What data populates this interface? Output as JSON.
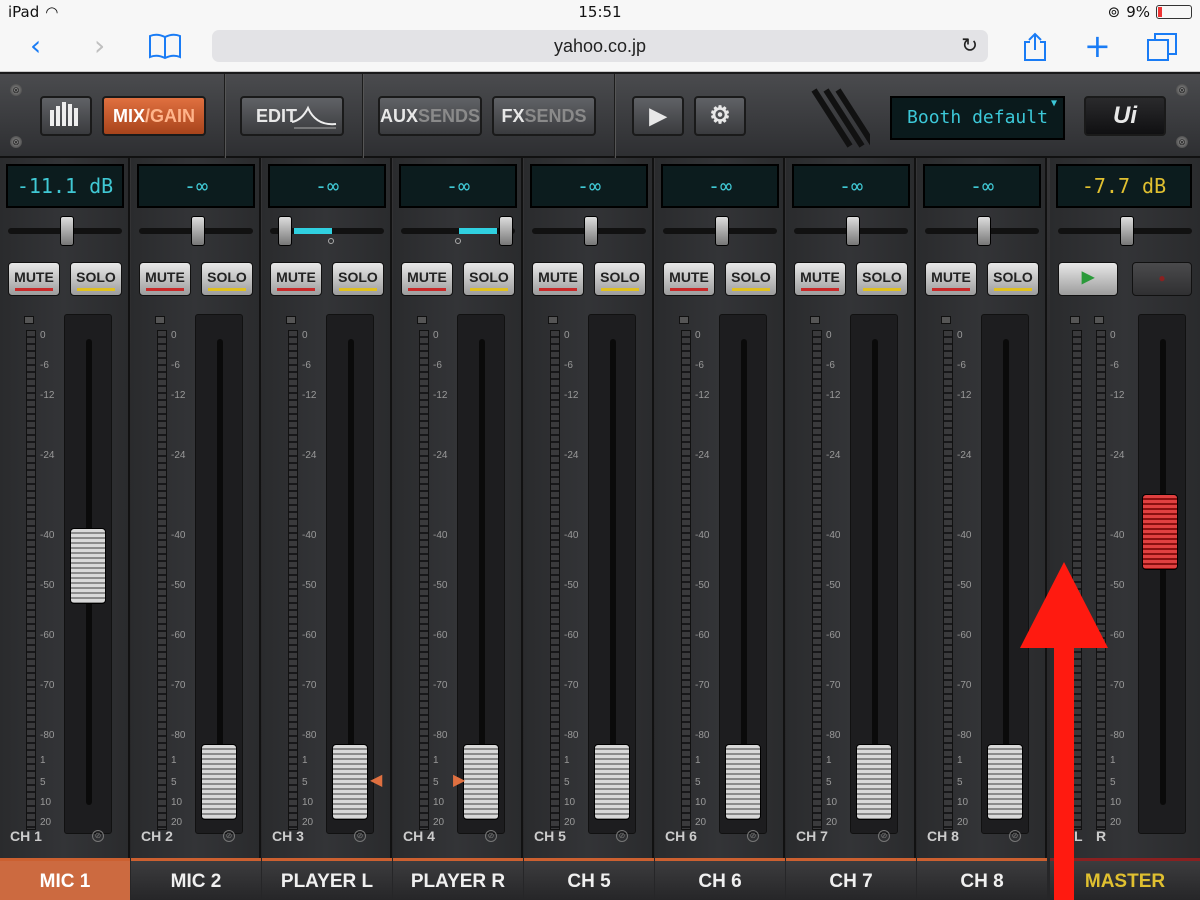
{
  "status": {
    "device": "iPad",
    "time": "15:51",
    "battery": "9%"
  },
  "browser": {
    "url": "yahoo.co.jp",
    "back": "‹",
    "fwd": "›",
    "reload": "↻",
    "share": "⇪",
    "add": "+",
    "tabs": "⧉",
    "bookmarks": "📖"
  },
  "toolbar": {
    "mix": "MIX",
    "gain": "/GAIN",
    "edit": "EDIT",
    "aux": "AUX",
    "auxsends": "SENDS",
    "fx": "FX",
    "fxsends": "SENDS",
    "play": "▶",
    "settings": "⚙",
    "preset": "Booth default",
    "logo": "Ui"
  },
  "channels": [
    {
      "gain": "-11.1 dB",
      "ch": "CH 1",
      "name": "MIC 1",
      "fader": "-40"
    },
    {
      "gain": "-∞",
      "ch": "CH 2",
      "name": "MIC 2",
      "fader": "-∞"
    },
    {
      "gain": "-∞",
      "ch": "CH 3",
      "name": "PLAYER L",
      "fader": "-∞"
    },
    {
      "gain": "-∞",
      "ch": "CH 4",
      "name": "PLAYER R",
      "fader": "-∞"
    },
    {
      "gain": "-∞",
      "ch": "CH 5",
      "name": "CH 5",
      "fader": "-∞"
    },
    {
      "gain": "-∞",
      "ch": "CH 6",
      "name": "CH 6",
      "fader": "-∞"
    },
    {
      "gain": "-∞",
      "ch": "CH 7",
      "name": "CH 7",
      "fader": "-∞"
    },
    {
      "gain": "-∞",
      "ch": "CH 8",
      "name": "CH 8",
      "fader": "-∞"
    }
  ],
  "master": {
    "gain": "-7.7 dB",
    "name": "MASTER",
    "l": "L",
    "r": "R"
  },
  "mute": "MUTE",
  "solo": "SOLO",
  "scale": [
    "0",
    "-6",
    "-12",
    "-24",
    "-40",
    "-50",
    "-60",
    "-70",
    "-80",
    "1",
    "5",
    "10",
    "20"
  ],
  "colors": {
    "accent": "#cc6a40",
    "display": "#40c8d4",
    "masterText": "#e0c030",
    "arrow": "#ff1a10"
  }
}
